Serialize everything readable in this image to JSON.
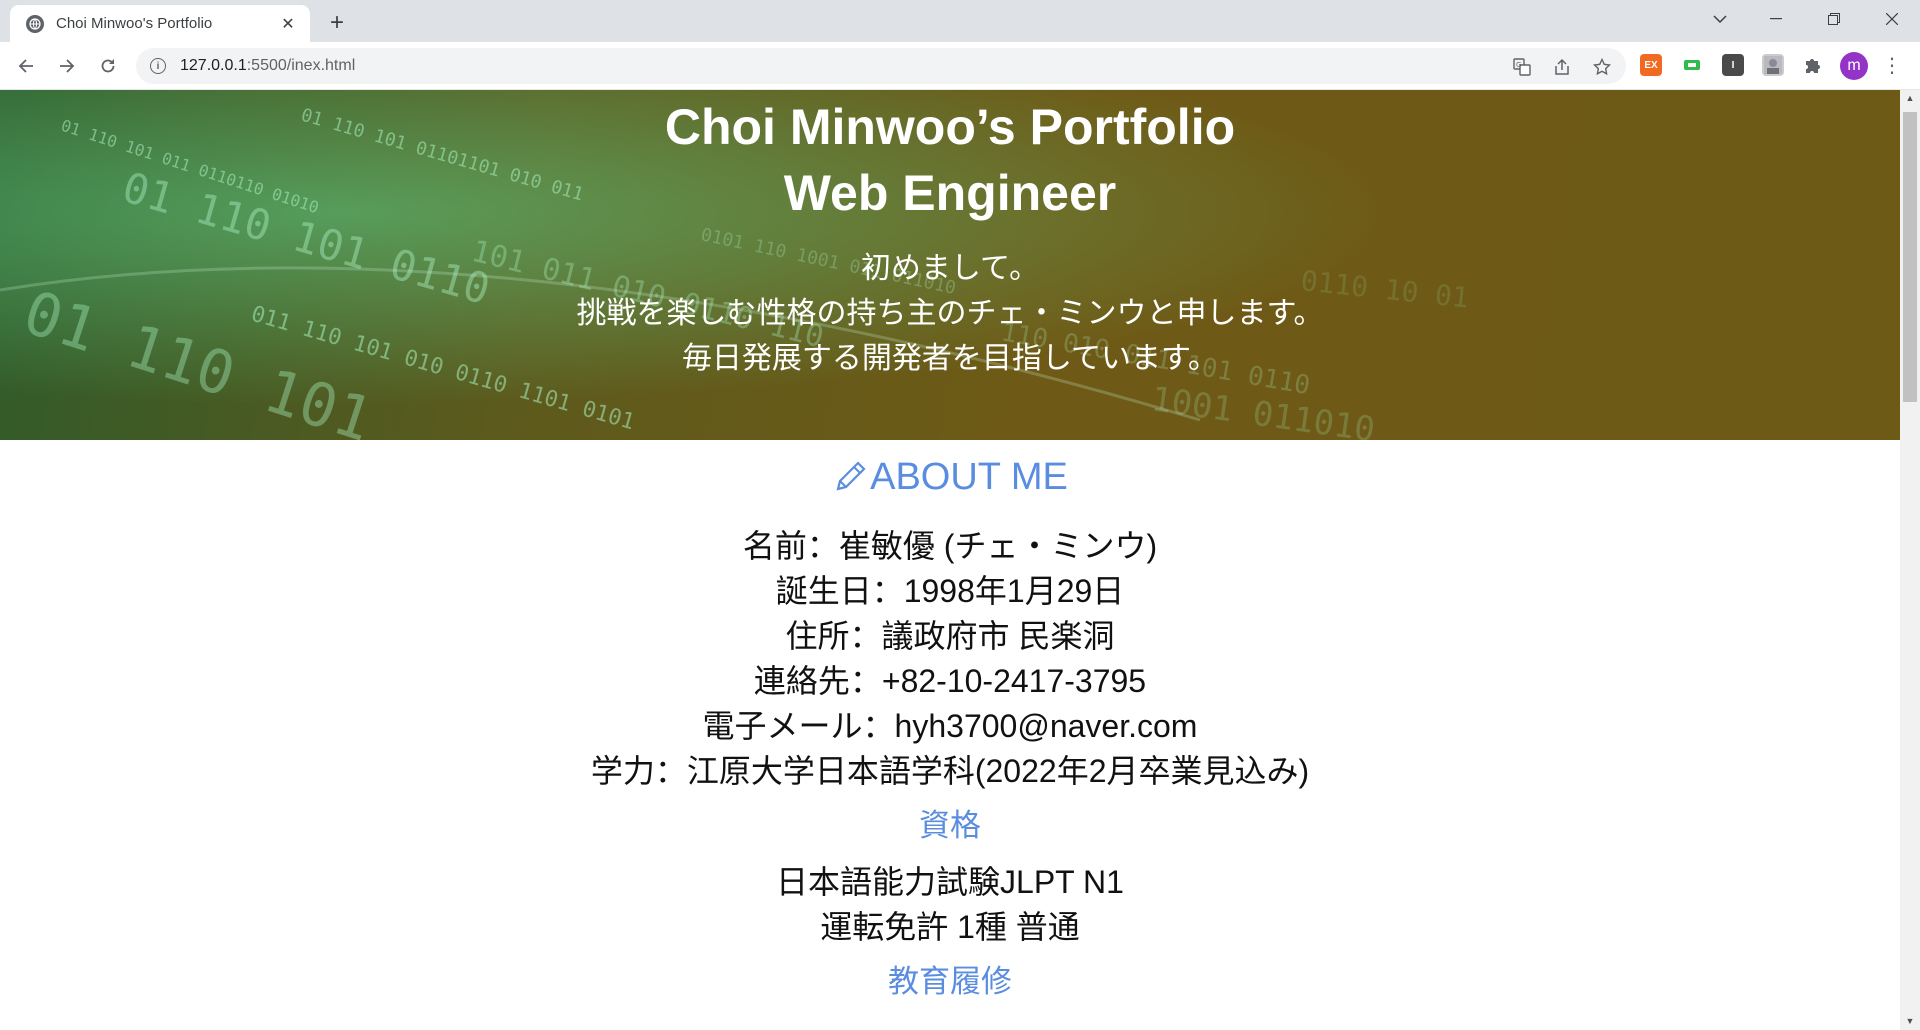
{
  "browser": {
    "tab_title": "Choi Minwoo's Portfolio",
    "url_host": "127.0.0.1",
    "url_rest": ":5500/inex.html"
  },
  "hero": {
    "title_line1": "Choi Minwoo’s Portfolio",
    "title_line2": "Web Engineer",
    "intro_line1": "初めまして。",
    "intro_line2": "挑戦を楽しむ性格の持ち主のチェ・ミンウと申します。",
    "intro_line3": "毎日発展する開発者を目指しています。"
  },
  "about": {
    "heading": "ABOUT ME",
    "lines": [
      "名前：崔敏優 (チェ・ミンウ)",
      "誕生日：1998年1月29日",
      "住所：議政府市 民楽洞",
      "連絡先：+82-10-2417-3795",
      "電子メール：hyh3700@naver.com",
      "学力：江原大学日本語学科(2022年2月卒業見込み)"
    ]
  },
  "certs": {
    "heading": "資格",
    "lines": [
      "日本語能力試験JLPT N1",
      "運転免許 1種 普通"
    ]
  },
  "education": {
    "heading": "教育履修"
  },
  "colors": {
    "heading_blue": "#5a8de0",
    "hero_gold": "#6e5a16",
    "profile_purple": "#9334c7"
  },
  "icons": [
    "globe-icon",
    "close-icon",
    "plus-icon",
    "back-icon",
    "forward-icon",
    "reload-icon",
    "info-icon",
    "translate-icon",
    "share-icon",
    "star-icon",
    "puzzle-icon",
    "pencil-icon"
  ]
}
